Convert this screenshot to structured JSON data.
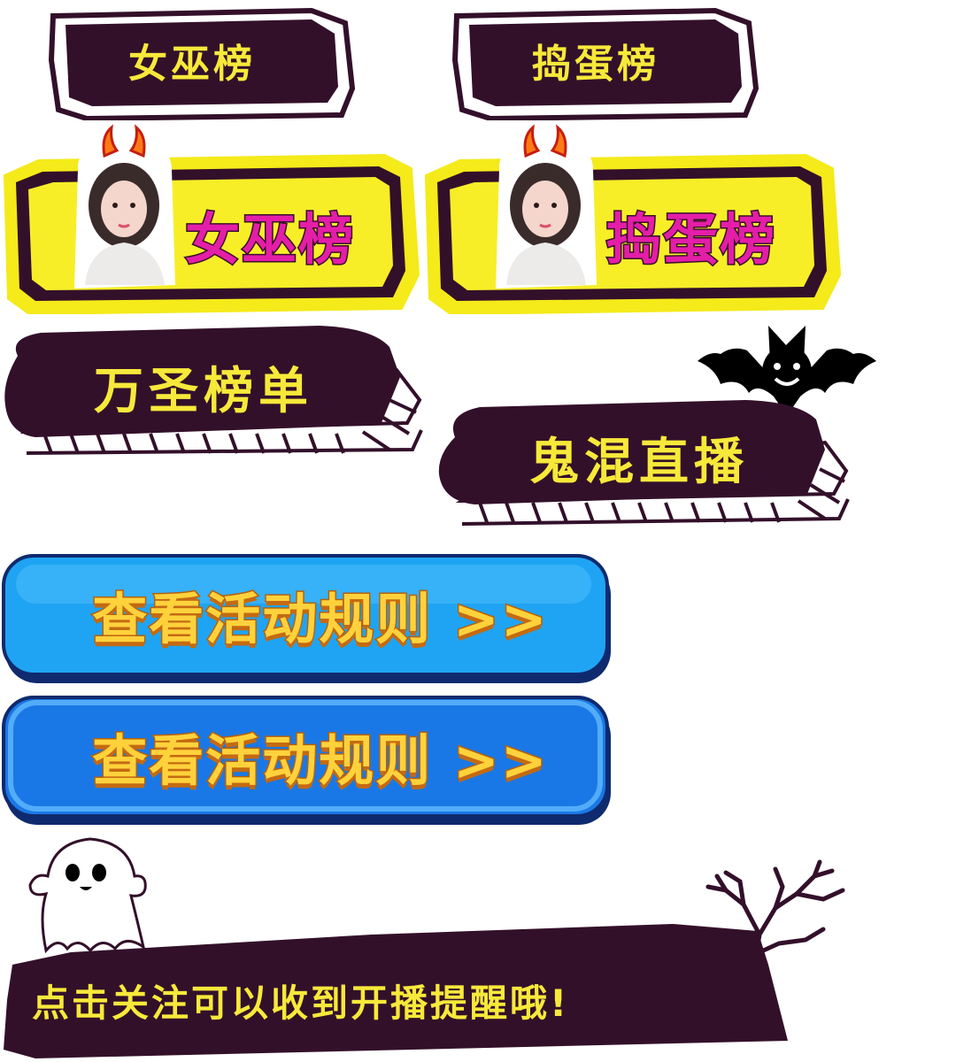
{
  "tabs": {
    "witch_plain": "女巫榜",
    "prank_plain": "捣蛋榜",
    "witch_active": "女巫榜",
    "prank_active": "捣蛋榜"
  },
  "banners": {
    "halloween_rank": "万圣榜单",
    "ghost_live": "鬼混直播"
  },
  "rule_buttons": {
    "light": "查看活动规则 >>",
    "dark": "查看活动规则 >>"
  },
  "footer": {
    "follow_tip": "点击关注可以收到开播提醒哦!"
  },
  "colors": {
    "dark_purple": "#33102a",
    "accent_yellow": "#f7e93a",
    "magenta": "#e41ea8",
    "blue_light": "#1fa4f3",
    "blue_dark": "#1a78e6"
  },
  "icons": [
    "devil-horns-icon",
    "avatar",
    "bat-icon",
    "ghost-icon",
    "dead-tree-icon"
  ]
}
